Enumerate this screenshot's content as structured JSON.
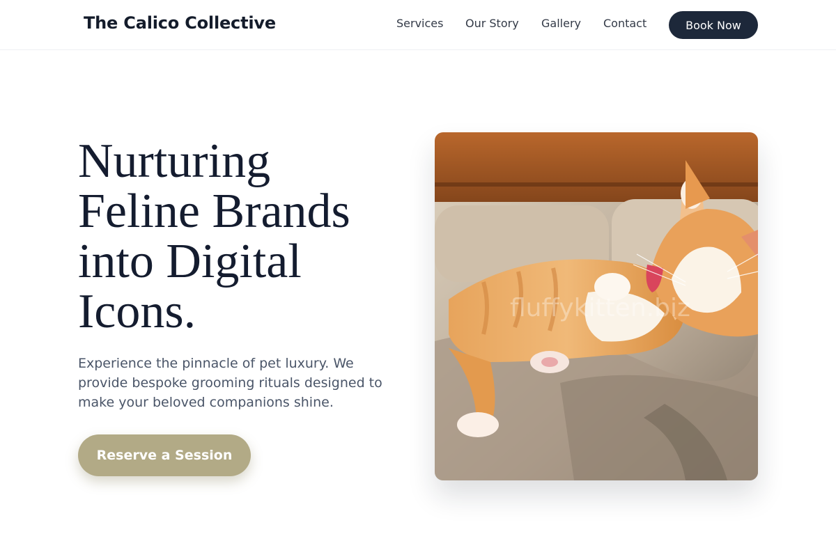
{
  "header": {
    "logo": "The Calico Collective",
    "nav": [
      "Services",
      "Our Story",
      "Gallery",
      "Contact"
    ],
    "book_label": "Book Now"
  },
  "hero": {
    "headline_lines": [
      "Nurturing",
      "Feline Brands",
      "into Digital",
      "Icons."
    ],
    "subtext_lines": [
      "Experience the pinnacle of pet luxury. We",
      "provide bespoke grooming rituals designed to",
      "make your beloved companions shine."
    ],
    "cta_label": "Reserve a Session",
    "image": {
      "subject": "orange-and-white-cat-grooming-paw-on-sofa",
      "watermark": "fluffykitten.biz"
    }
  },
  "colors": {
    "primary_dark": "#1d283a",
    "cta_accent": "#b2aa86",
    "body_text": "#4a5568",
    "headline": "#141c2f"
  }
}
